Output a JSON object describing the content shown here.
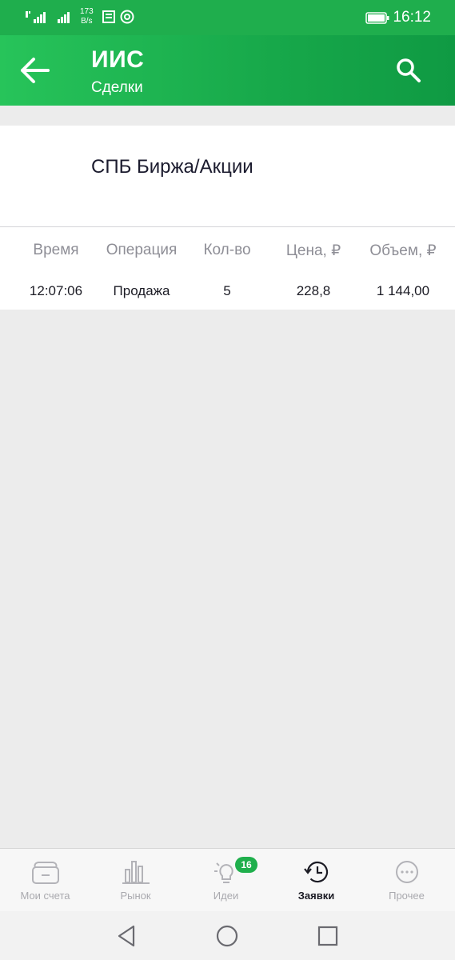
{
  "status_bar": {
    "net_speed_value": "173",
    "net_speed_unit": "B/s",
    "time": "16:12"
  },
  "app_bar": {
    "title": "ИИС",
    "subtitle": "Сделки"
  },
  "exchange": {
    "title": "СПБ Биржа/Акции"
  },
  "table": {
    "headers": [
      "Время",
      "Операция",
      "Кол-во",
      "Цена, ₽",
      "Объем, ₽"
    ],
    "rows": [
      {
        "time": "12:07:06",
        "operation": "Продажа",
        "qty": "5",
        "price": "228,8",
        "volume": "1 144,00"
      }
    ]
  },
  "bottom_nav": {
    "items": [
      {
        "label": "Мои счета",
        "icon": "wallet-icon"
      },
      {
        "label": "Рынок",
        "icon": "bar-chart-icon"
      },
      {
        "label": "Идеи",
        "icon": "lightbulb-icon",
        "badge": "16"
      },
      {
        "label": "Заявки",
        "icon": "history-clock-icon",
        "active": true
      },
      {
        "label": "Прочее",
        "icon": "more-dots-icon"
      }
    ]
  },
  "colors": {
    "brand_green": "#1fae4d",
    "badge_green": "#1faf4c",
    "background": "#ececec"
  }
}
